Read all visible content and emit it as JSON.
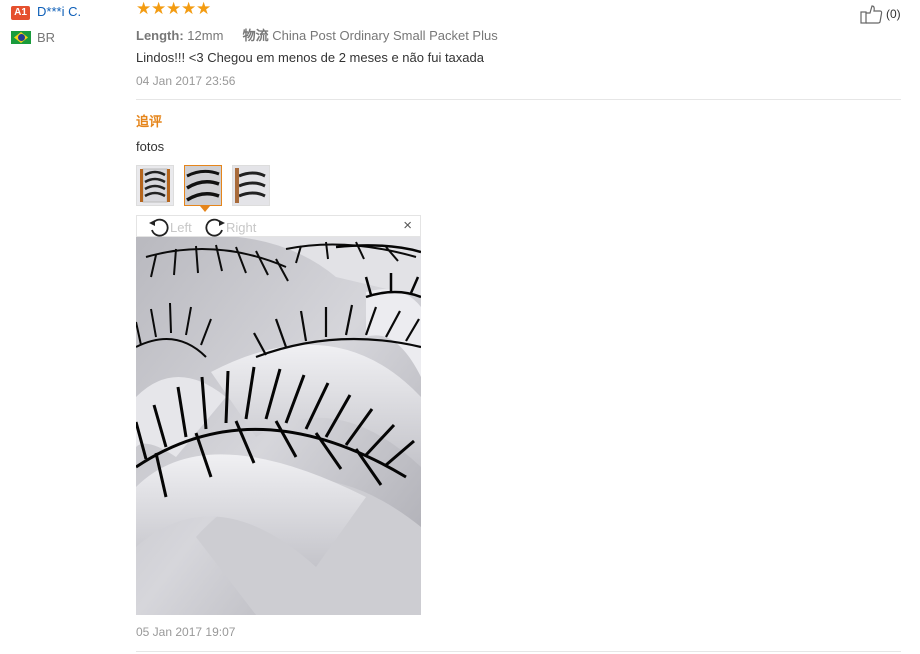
{
  "buyer": {
    "level": "A1",
    "name": "D***i C.",
    "country": "BR"
  },
  "review": {
    "rating": 5,
    "meta": {
      "length_label": "Length:",
      "length_value": "12mm",
      "shipping_label": "物流",
      "shipping_value": "China Post Ordinary Small Packet Plus"
    },
    "text": "Lindos!!! <3 Chegou em menos de 2 meses e não fui taxada",
    "date": "04 Jan 2017 23:56"
  },
  "additional": {
    "label": "追评",
    "text": "fotos",
    "photos_count": 3,
    "active_photo": 2,
    "date": "05 Jan 2017 19:07"
  },
  "viewer": {
    "rotate_left": "Left",
    "rotate_right": "Right",
    "close": "×"
  },
  "like": {
    "count": "(0)"
  },
  "colors": {
    "accent_orange": "#e5851b",
    "star": "#f39c12",
    "link_blue": "#0e5fb8",
    "badge_red": "#e5502e"
  }
}
